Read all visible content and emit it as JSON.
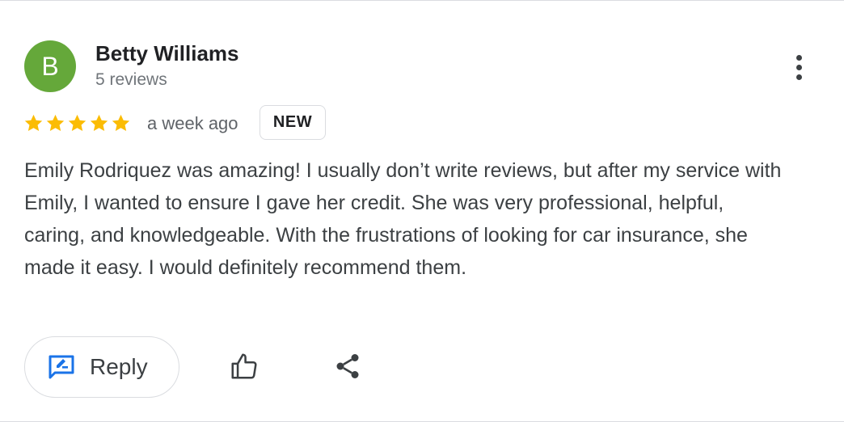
{
  "review": {
    "avatar_letter": "B",
    "reviewer_name": "Betty Williams",
    "review_count": "5 reviews",
    "rating": 5,
    "rating_max": 5,
    "time_ago": "a week ago",
    "badge": "NEW",
    "text": "Emily Rodriquez was amazing! I usually don’t write reviews, but after my service with Emily, I wanted to ensure I gave her credit. She was very professional, helpful, caring, and knowledgeable. With the frustrations of looking for car insurance, she made it easy. I would definitely recommend them."
  },
  "actions": {
    "reply_label": "Reply",
    "reply_icon": "reply-edit-icon",
    "like_icon": "thumbs-up-icon",
    "share_icon": "share-icon",
    "more_icon": "more-vert-icon"
  },
  "colors": {
    "avatar": "#65a83a",
    "star": "#fbbc04",
    "reply_icon": "#1a73e8"
  }
}
